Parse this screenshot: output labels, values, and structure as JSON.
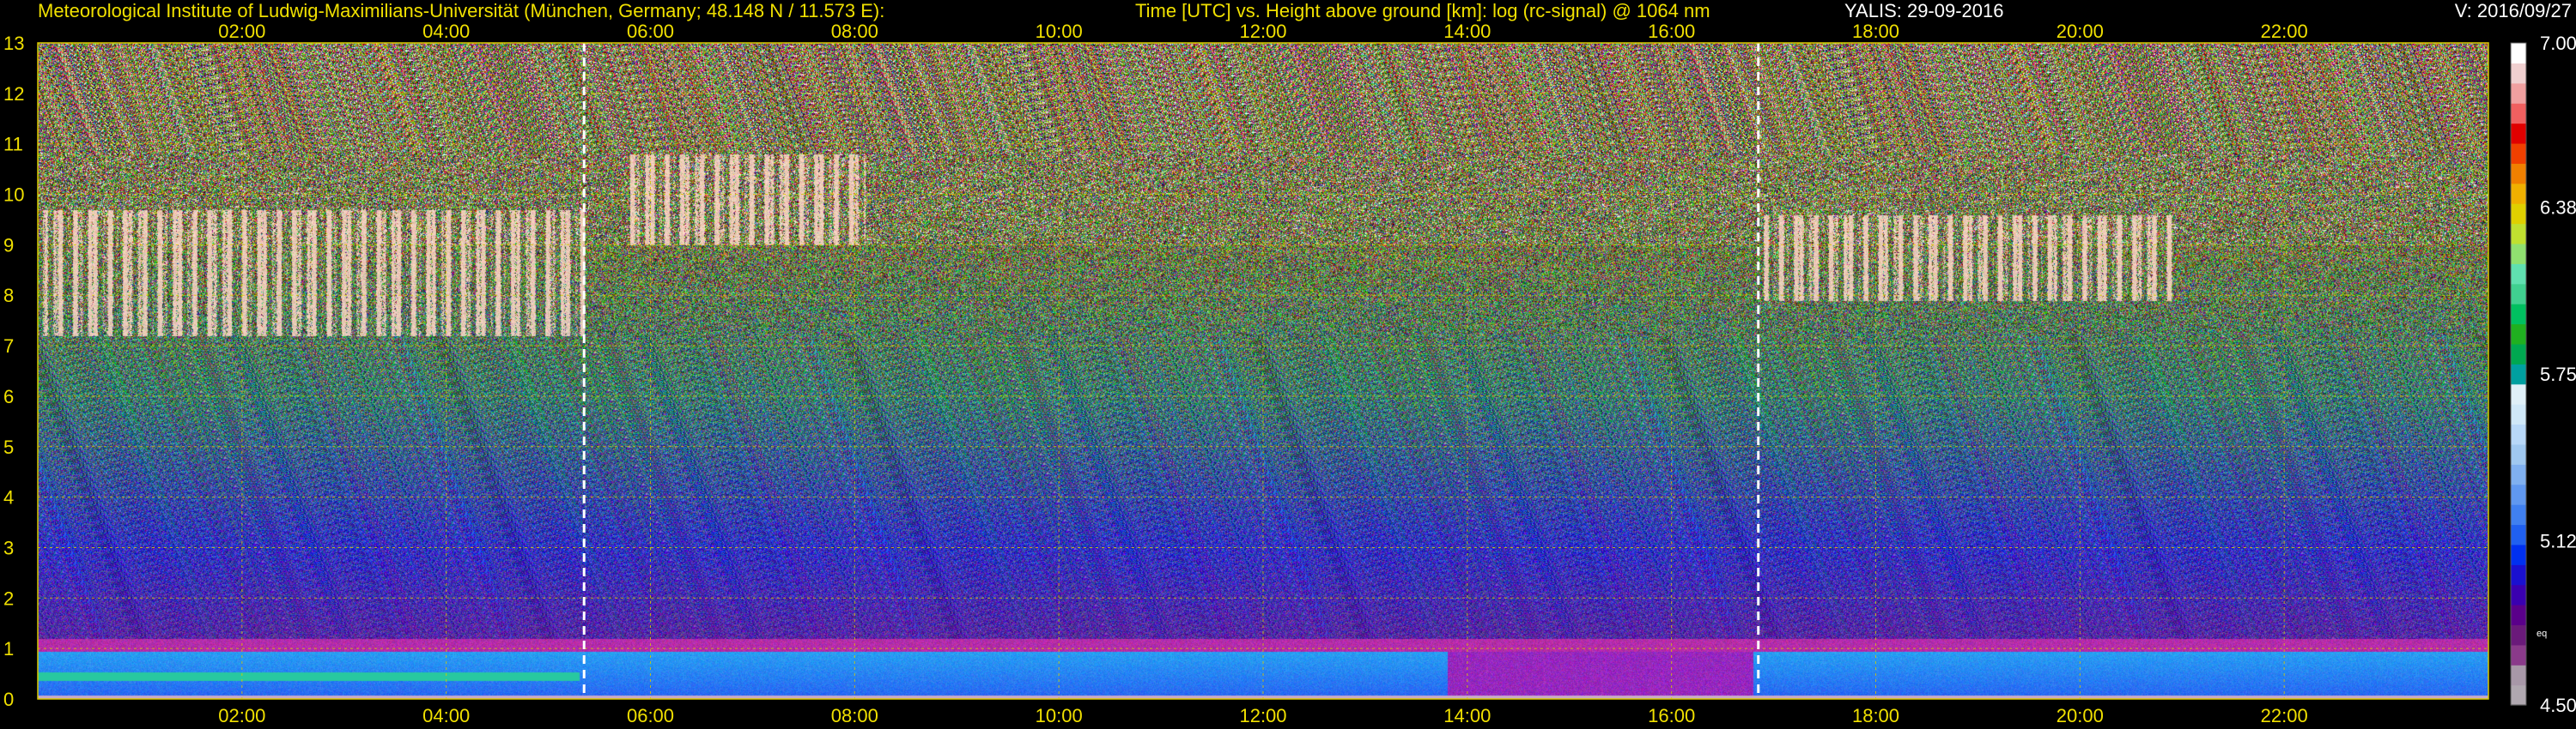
{
  "header": {
    "institute": "Meteorological Institute of Ludwig-Maximilians-Universität (München, Germany; 48.148 N / 11.573 E):",
    "axes_desc": "Time [UTC] vs. Height above ground [km]: log (rc-signal) @ 1064 nm",
    "station_date": "YALIS: 29-09-2016",
    "version": "V: 2016/09/27"
  },
  "chart_data": {
    "type": "heatmap",
    "xlabel": "Time [UTC]",
    "ylabel": "Height above ground [km]",
    "xlim": [
      0,
      24
    ],
    "ylim": [
      0,
      13
    ],
    "x_ticks": [
      {
        "value": 2,
        "label": "02:00"
      },
      {
        "value": 4,
        "label": "04:00"
      },
      {
        "value": 6,
        "label": "06:00"
      },
      {
        "value": 8,
        "label": "08:00"
      },
      {
        "value": 10,
        "label": "10:00"
      },
      {
        "value": 12,
        "label": "12:00"
      },
      {
        "value": 14,
        "label": "14:00"
      },
      {
        "value": 16,
        "label": "16:00"
      },
      {
        "value": 18,
        "label": "18:00"
      },
      {
        "value": 20,
        "label": "20:00"
      },
      {
        "value": 22,
        "label": "22:00"
      }
    ],
    "y_ticks": [
      0,
      1,
      2,
      3,
      4,
      5,
      6,
      7,
      8,
      9,
      10,
      11,
      12,
      13
    ],
    "grid": true,
    "markers": [
      5.35,
      16.85
    ],
    "colorbar": {
      "min": 4.5,
      "max": 7.0,
      "tick_labels": [
        "7.00",
        "6.38",
        "5.75",
        "5.12",
        "4.50"
      ],
      "extra_label": "eq",
      "colors": [
        "#b0a8b0",
        "#a898a8",
        "#8a3a8a",
        "#6a1a7a",
        "#5a008a",
        "#3a00b0",
        "#1a10d0",
        "#0030f0",
        "#2060f0",
        "#4080f0",
        "#6098f0",
        "#80b0f0",
        "#a0c8f0",
        "#b8d8f8",
        "#d0e8f8",
        "#e0f0f8",
        "#00a0a0",
        "#00a850",
        "#20b020",
        "#00c060",
        "#40d090",
        "#60e0b0",
        "#90e070",
        "#c0e030",
        "#e0d000",
        "#f0b000",
        "#f08000",
        "#f04000",
        "#e00000",
        "#f06060",
        "#f0a0a0",
        "#f0d0d0",
        "#ffffff"
      ]
    },
    "cloud_regions": [
      {
        "t0": 0.05,
        "t1": 5.35,
        "h0": 7.2,
        "h1": 9.7,
        "kind": "cirrus"
      },
      {
        "t0": 5.8,
        "t1": 8.1,
        "h0": 9.0,
        "h1": 10.8,
        "kind": "cirrus"
      },
      {
        "t0": 16.9,
        "t1": 20.9,
        "h0": 7.9,
        "h1": 9.6,
        "kind": "cirrus"
      }
    ],
    "boundary_layer": {
      "top_km": 0.95,
      "core_km": 0.45
    }
  }
}
